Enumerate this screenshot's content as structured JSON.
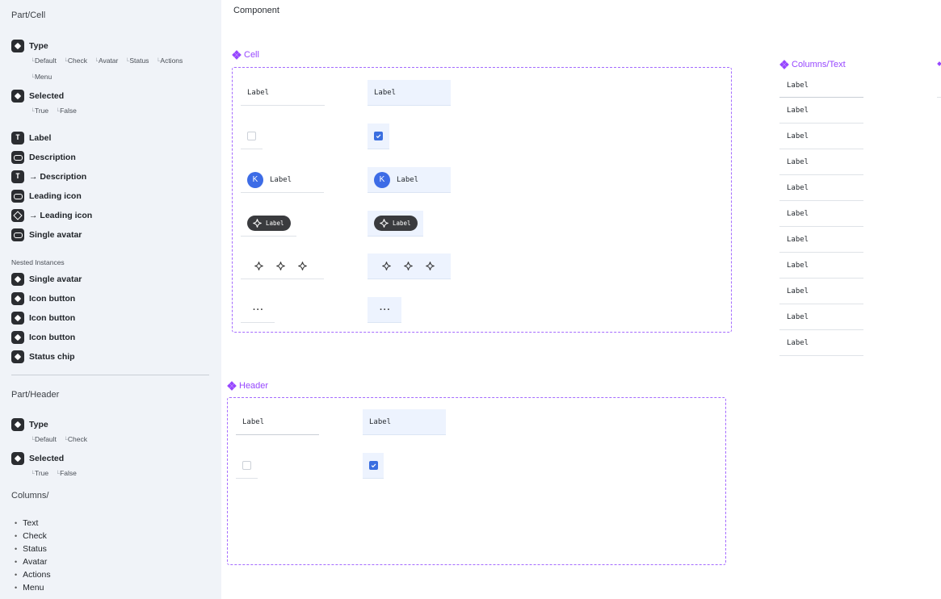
{
  "sidebar": {
    "cell_section_title": "Part/Cell",
    "type_label": "Type",
    "type_options_line1": [
      "Default",
      "Check",
      "Avatar",
      "Status",
      "Actions"
    ],
    "type_options_line2": [
      "Menu"
    ],
    "selected_label": "Selected",
    "selected_options": [
      "True",
      "False"
    ],
    "props": [
      "Label",
      "Description",
      "→ Description",
      "Leading icon",
      "→ Leading icon",
      "Single avatar"
    ],
    "nested_title": "Nested Instances",
    "nested": [
      "Single avatar",
      "Icon button",
      "Icon button",
      "Icon button",
      "Status chip"
    ],
    "header_section_title": "Part/Header",
    "header_type_label": "Type",
    "header_type_options": [
      "Default",
      "Check"
    ],
    "header_selected_label": "Selected",
    "header_selected_options": [
      "True",
      "False"
    ],
    "columns_title": "Columns/",
    "columns": [
      "Text",
      "Check",
      "Status",
      "Avatar",
      "Actions",
      "Menu"
    ]
  },
  "canvas": {
    "page_title": "Component",
    "cell_frame_title": "Cell",
    "header_frame_title": "Header",
    "columns_text_title": "Columns/Text",
    "cell_label": "Label",
    "avatar_initial": "K",
    "chip_label": "Label",
    "menu_dots": "···",
    "column_cells": [
      "Label",
      "Label",
      "Label",
      "Label",
      "Label",
      "Label",
      "Label",
      "Label",
      "Label",
      "Label",
      "Label"
    ]
  },
  "colors": {
    "accent": "#9747ff",
    "selected_bg": "#edf3fe",
    "checkbox_on": "#3b6fe0",
    "avatar": "#3d6ce6",
    "chip": "#3a3b3e"
  }
}
